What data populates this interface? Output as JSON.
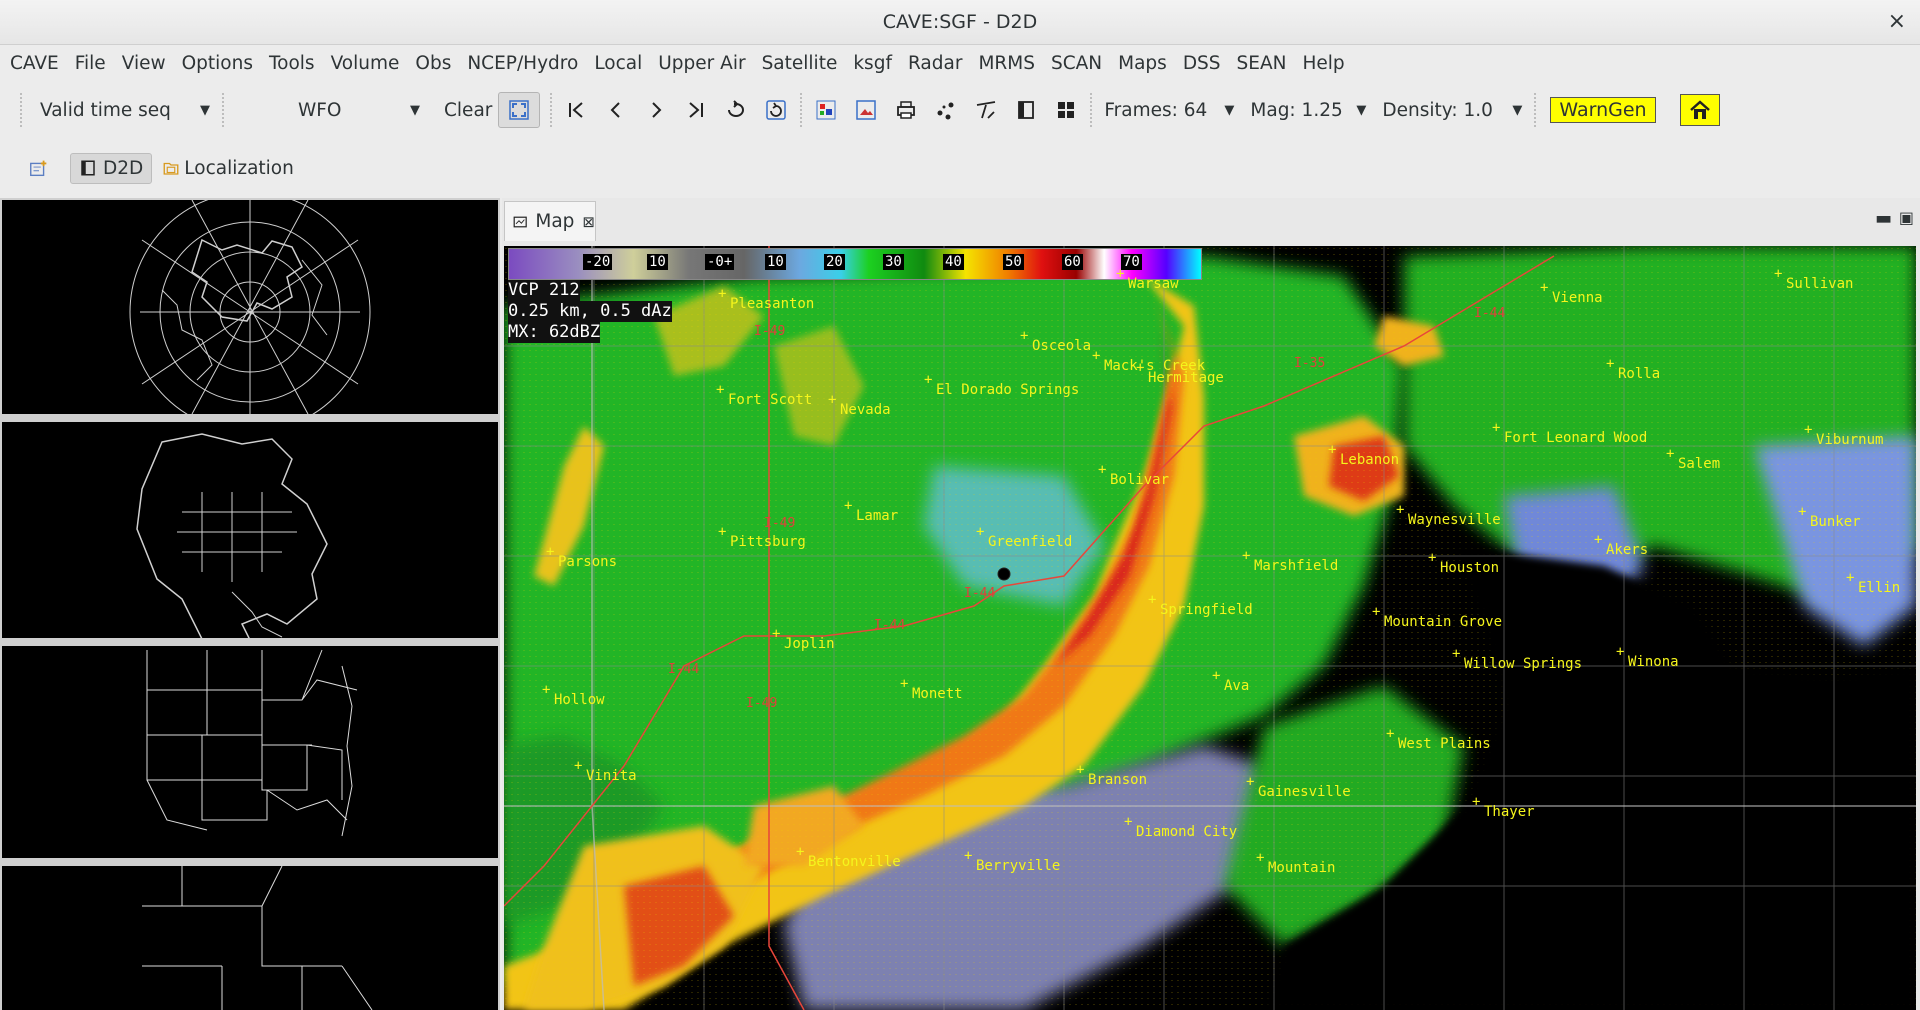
{
  "window": {
    "title": "CAVE:SGF - D2D",
    "close_glyph": "×"
  },
  "menu": [
    "CAVE",
    "File",
    "View",
    "Options",
    "Tools",
    "Volume",
    "Obs",
    "NCEP/Hydro",
    "Local",
    "Upper Air",
    "Satellite",
    "ksgf",
    "Radar",
    "MRMS",
    "SCAN",
    "Maps",
    "DSS",
    "SEAN",
    "Help"
  ],
  "toolbar": {
    "time_mode": "Valid time seq",
    "scale": "WFO",
    "clear_label": "Clear",
    "frames": "Frames: 64",
    "mag": "Mag: 1.25",
    "density": "Density: 1.0",
    "warngen_label": "WarnGen"
  },
  "perspective": {
    "d2d_label": "D2D",
    "localization_label": "Localization"
  },
  "editor": {
    "tab_label": "Map",
    "tab_close": "⊠"
  },
  "colorbar": [
    "-20",
    "10",
    "-0+",
    "10",
    "20",
    "30",
    "40",
    "50",
    "60",
    "70"
  ],
  "legend": {
    "vcp": "VCP 212",
    "res": "0.25 km, 0.5 dAz",
    "max": "MX: 62dBZ"
  },
  "towns": [
    "Warsaw",
    "Sullivan",
    "Vienna",
    "Pleasanton",
    "Osceola",
    "Hermitage",
    "Rolla",
    "El Dorado Springs",
    "Fort Scott",
    "Nevada",
    "Fort Leonard Wood",
    "Lebanon",
    "Viburnum",
    "Salem",
    "Bolivar",
    "Lamar",
    "Pittsburg",
    "Greenfield",
    "Waynesville",
    "Bunker",
    "Parsons",
    "Marshfield",
    "Houston",
    "Akers",
    "Springfield",
    "Mountain Grove",
    "Joplin",
    "Willow Springs",
    "Winona",
    "Hollow",
    "Monett",
    "Ava",
    "West Plains",
    "Branson",
    "Vinita",
    "Gainesville",
    "Thayer",
    "Diamond City",
    "Bentonville",
    "Berryville",
    "Mountain",
    "Ellin",
    "Mack's Creek"
  ],
  "highways": [
    "I-44",
    "I-49",
    "I-35"
  ],
  "icons": [
    "first-frame-icon",
    "prev-frame-icon",
    "next-frame-icon",
    "last-frame-icon",
    "loop-icon",
    "refresh-icon",
    "color-table-icon",
    "image-icon",
    "print-icon",
    "points-icon",
    "baselines-icon",
    "panel-icon",
    "panel-4-icon",
    "home-icon"
  ]
}
